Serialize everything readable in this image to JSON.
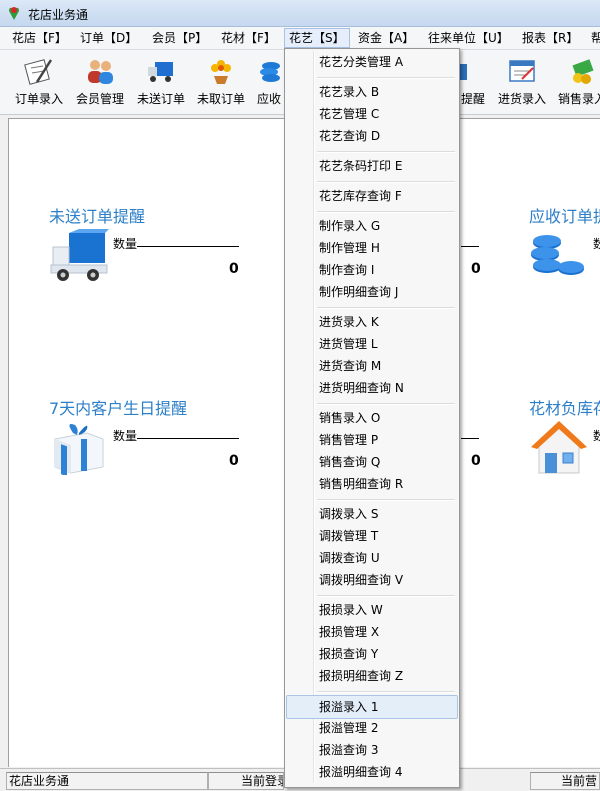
{
  "window": {
    "title": "花店业务通"
  },
  "menubar": [
    {
      "label": "花店【F】"
    },
    {
      "label": "订单【D】"
    },
    {
      "label": "会员【P】"
    },
    {
      "label": "花材【F】"
    },
    {
      "label": "花艺【S】"
    },
    {
      "label": "资金【A】"
    },
    {
      "label": "往来单位【U】"
    },
    {
      "label": "报表【R】"
    },
    {
      "label": "帮"
    }
  ],
  "toolbar": [
    {
      "label": "订单录入",
      "icon": "order-entry-icon"
    },
    {
      "label": "会员管理",
      "icon": "members-icon"
    },
    {
      "label": "未送订单",
      "icon": "truck-icon"
    },
    {
      "label": "未取订单",
      "icon": "flower-icon"
    },
    {
      "label": "应收",
      "icon": "coins-icon"
    },
    {
      "label": "提醒",
      "icon": "reminder-icon"
    },
    {
      "label": "进货录入",
      "icon": "purchase-entry-icon"
    },
    {
      "label": "销售录入",
      "icon": "sales-entry-icon"
    }
  ],
  "panels": {
    "unsent": {
      "title": "未送订单提醒",
      "qty_label": "数量",
      "value": "0",
      "icon": "delivery-truck-icon"
    },
    "middle_top": {
      "value": "0"
    },
    "receivable": {
      "title": "应收订单提",
      "qty_label": "数",
      "icon": "coin-stack-icon"
    },
    "birthday": {
      "title": "7天内客户生日提醒",
      "qty_label": "数量",
      "value": "0",
      "icon": "gift-box-icon"
    },
    "middle_bottom": {
      "value": "0"
    },
    "negative_stock": {
      "title": "花材负库存",
      "qty_label": "数",
      "icon": "house-icon"
    }
  },
  "statusbar": {
    "app": "花店业务通",
    "login": "当前登录",
    "right": "当前营"
  },
  "dropdown": {
    "groups": [
      [
        "花艺分类管理 A"
      ],
      [
        "花艺录入 B",
        "花艺管理 C",
        "花艺查询 D"
      ],
      [
        "花艺条码打印 E"
      ],
      [
        "花艺库存查询 F"
      ],
      [
        "制作录入 G",
        "制作管理 H",
        "制作查询 I",
        "制作明细查询 J"
      ],
      [
        "进货录入 K",
        "进货管理 L",
        "进货查询 M",
        "进货明细查询 N"
      ],
      [
        "销售录入 O",
        "销售管理 P",
        "销售查询 Q",
        "销售明细查询 R"
      ],
      [
        "调拨录入 S",
        "调拨管理 T",
        "调拨查询 U",
        "调拨明细查询 V"
      ],
      [
        "报损录入 W",
        "报损管理 X",
        "报损查询 Y",
        "报损明细查询 Z"
      ],
      [
        "报溢录入 1",
        "报溢管理 2",
        "报溢查询 3",
        "报溢明细查询 4"
      ]
    ],
    "highlighted": "报溢录入 1"
  },
  "colors": {
    "accent": "#2c7fc8",
    "highlight": "#e4eef9"
  }
}
